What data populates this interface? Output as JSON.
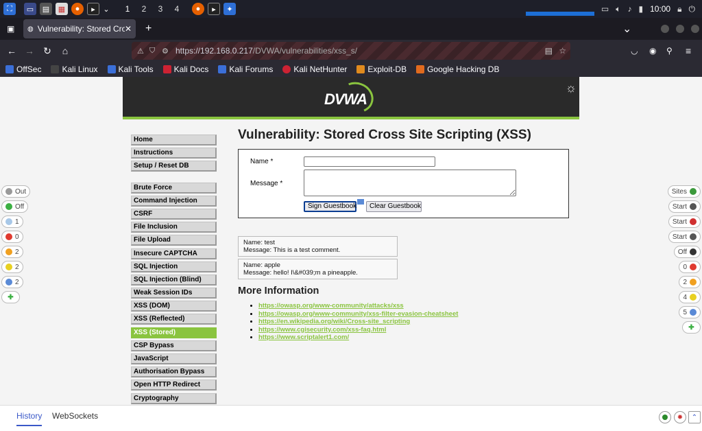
{
  "taskbar": {
    "workspaces": [
      "1",
      "2",
      "3",
      "4"
    ],
    "clock": "10:00"
  },
  "browser": {
    "tab_title": "Vulnerability: Stored Cros",
    "url": "https://192.168.0.217/DVWA/vulnerabilities/xss_s/",
    "url_host": "https://192.168.0.217",
    "url_path": "/DVWA/vulnerabilities/xss_s/",
    "bookmarks": [
      "OffSec",
      "Kali Linux",
      "Kali Tools",
      "Kali Docs",
      "Kali Forums",
      "Kali NetHunter",
      "Exploit-DB",
      "Google Hacking DB"
    ]
  },
  "page": {
    "logo": "DVWA",
    "menu": [
      "Home",
      "Instructions",
      "Setup / Reset DB",
      "Brute Force",
      "Command Injection",
      "CSRF",
      "File Inclusion",
      "File Upload",
      "Insecure CAPTCHA",
      "SQL Injection",
      "SQL Injection (Blind)",
      "Weak Session IDs",
      "XSS (DOM)",
      "XSS (Reflected)",
      "XSS (Stored)",
      "CSP Bypass",
      "JavaScript",
      "Authorisation Bypass",
      "Open HTTP Redirect",
      "Cryptography"
    ],
    "selected_menu": "XSS (Stored)",
    "title": "Vulnerability: Stored Cross Site Scripting (XSS)",
    "form": {
      "name_label": "Name *",
      "message_label": "Message *",
      "name_value": "",
      "message_value": "",
      "sign_button": "Sign Guestbook",
      "clear_button": "Clear Guestbook"
    },
    "entries": [
      {
        "name": "Name: test",
        "message": "Message: This is a test comment."
      },
      {
        "name": "Name: apple",
        "message": "Message: hello! I\\&#039;m a pineapple."
      }
    ],
    "more_info_title": "More Information",
    "links": [
      "https://owasp.org/www-community/attacks/xss",
      "https://owasp.org/www-community/xss-filter-evasion-cheatsheet",
      "https://en.wikipedia.org/wiki/Cross-site_scripting",
      "https://www.cgisecurity.com/xss-faq.html",
      "https://www.scriptalert1.com/"
    ]
  },
  "left_pills": [
    {
      "label": "Out",
      "color": "#9a9a9a"
    },
    {
      "label": "Off",
      "color": "#3cb043"
    },
    {
      "label": "1",
      "color": "#a8c8e8"
    },
    {
      "label": "0",
      "color": "#e03a2f"
    },
    {
      "label": "2",
      "color": "#f0a020"
    },
    {
      "label": "2",
      "color": "#e8d020"
    },
    {
      "label": "2",
      "color": "#5a8ad6"
    }
  ],
  "right_pills": [
    {
      "label": "Sites",
      "color": "#3c9a3c"
    },
    {
      "label": "Start",
      "color": "#555555"
    },
    {
      "label": "Start",
      "color": "#d03030"
    },
    {
      "label": "Start",
      "color": "#555555"
    },
    {
      "label": "Off",
      "color": "#333333"
    },
    {
      "label": "0",
      "color": "#e03a2f"
    },
    {
      "label": "2",
      "color": "#f0a020"
    },
    {
      "label": "4",
      "color": "#e8d020"
    },
    {
      "label": "5",
      "color": "#5a8ad6"
    }
  ],
  "bottom": {
    "history_tab": "History",
    "websockets_tab": "WebSockets"
  }
}
